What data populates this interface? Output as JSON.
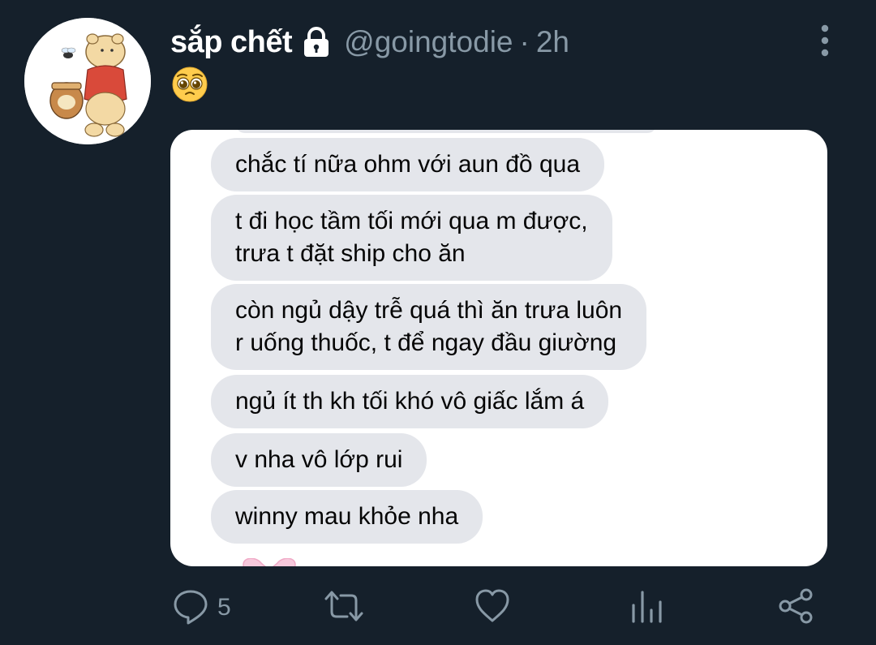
{
  "tweet": {
    "display_name": "sắp chết",
    "handle": "@goingtodie",
    "separator": "·",
    "time": "2h",
    "text_emoji": "pleading-face-emoji"
  },
  "messages": [
    {
      "lines": [
        "chắc tí nữa ohm với aun đồ qua"
      ]
    },
    {
      "lines": [
        "t đi học tầm tối mới qua m được,",
        "trưa t đặt ship cho ăn"
      ]
    },
    {
      "lines": [
        "còn ngủ dậy trễ quá thì ăn trưa luôn",
        "r uống thuốc, t để ngay đầu giường"
      ]
    },
    {
      "lines": [
        "ngủ ít th kh tối khó vô giấc lắm á"
      ]
    },
    {
      "lines": [
        "v nha vô lớp rui"
      ]
    },
    {
      "lines": [
        "winny mau khỏe nha"
      ]
    }
  ],
  "actions": {
    "reply_count": "5",
    "icons": [
      "reply-icon",
      "retweet-icon",
      "like-icon",
      "analytics-icon",
      "share-icon"
    ]
  },
  "colors": {
    "background": "#15202b",
    "secondary_text": "#8899a6",
    "bubble": "#e4e6eb"
  }
}
